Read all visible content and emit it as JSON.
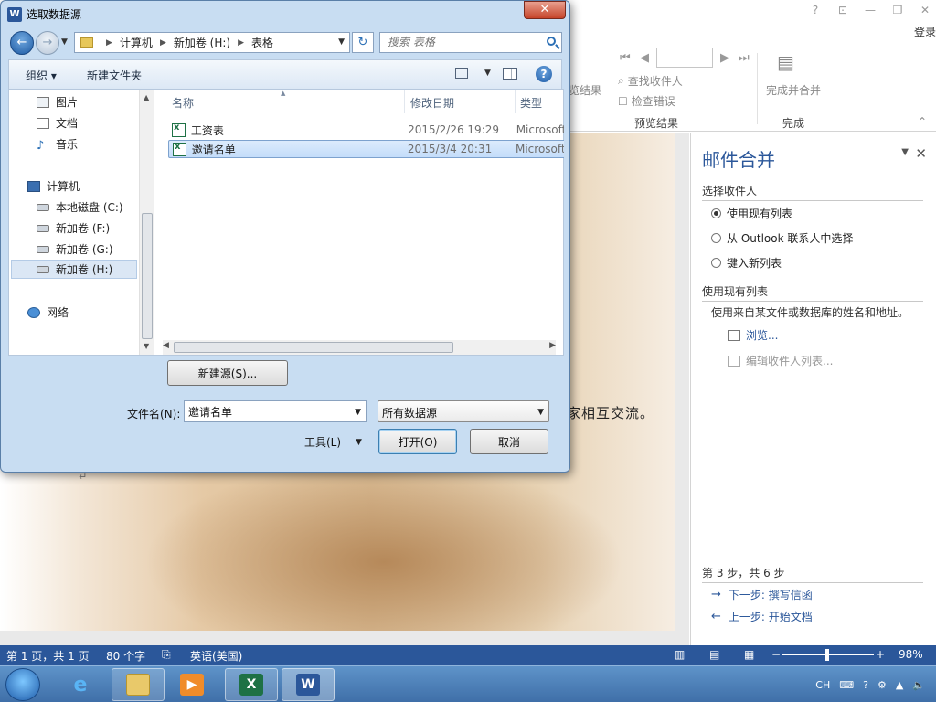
{
  "word": {
    "login": "登录",
    "ribbon": {
      "preview_results_cut": "览结果",
      "find_recipient": "查找收件人",
      "check_errors": "检查错误",
      "group_preview": "预览结果",
      "finish_merge": "完成并合并",
      "group_finish": "完成"
    },
    "doc_text": "家相互交流。",
    "doc_paragraph_mark": "↵"
  },
  "mail_merge": {
    "title": "邮件合并",
    "section_select": "选择收件人",
    "options": [
      {
        "label": "使用现有列表",
        "checked": true
      },
      {
        "label": "从 Outlook 联系人中选择",
        "checked": false
      },
      {
        "label": "键入新列表",
        "checked": false
      }
    ],
    "section_use": "使用现有列表",
    "use_desc": "使用来自某文件或数据库的姓名和地址。",
    "browse": "浏览...",
    "edit_list": "编辑收件人列表...",
    "step": "第 3 步，共 6 步",
    "next": "下一步: 撰写信函",
    "prev": "上一步: 开始文档",
    "link_color": "#2b579a"
  },
  "statusbar": {
    "page": "第 1 页，共 1 页",
    "words": "80 个字",
    "language": "英语(美国)",
    "zoom": "98%",
    "zoom_level": 0.49,
    "color": "#2b579a"
  },
  "taskbar": {
    "tray_lang": "CH"
  },
  "dialog": {
    "title": "选取数据源",
    "close": "✕",
    "breadcrumb": [
      "计算机",
      "新加卷 (H:)",
      "表格"
    ],
    "search_placeholder": "搜索 表格",
    "organize": "组织 ▾",
    "new_folder": "新建文件夹",
    "help": "?",
    "nav_items": [
      {
        "label": "图片",
        "icon": "picture-icon"
      },
      {
        "label": "文档",
        "icon": "document-icon"
      },
      {
        "label": "音乐",
        "icon": "music-icon"
      },
      {
        "label": "计算机",
        "icon": "computer-icon"
      },
      {
        "label": "本地磁盘 (C:)",
        "icon": "drive-icon"
      },
      {
        "label": "新加卷 (F:)",
        "icon": "drive-icon"
      },
      {
        "label": "新加卷 (G:)",
        "icon": "drive-icon"
      },
      {
        "label": "新加卷 (H:)",
        "icon": "drive-icon",
        "selected": true
      },
      {
        "label": "网络",
        "icon": "network-icon"
      }
    ],
    "columns": {
      "name": "名称",
      "date": "修改日期",
      "type": "类型"
    },
    "files": [
      {
        "name": "工资表",
        "date": "2015/2/26 19:29",
        "type": "Microsoft",
        "selected": false
      },
      {
        "name": "邀请名单",
        "date": "2015/3/4 20:31",
        "type": "Microsoft",
        "selected": true
      }
    ],
    "new_source": "新建源(S)...",
    "filename_label": "文件名(N):",
    "filename_value": "邀请名单",
    "filter_value": "所有数据源",
    "tools": "工具(L)",
    "open": "打开(O)",
    "cancel": "取消"
  }
}
